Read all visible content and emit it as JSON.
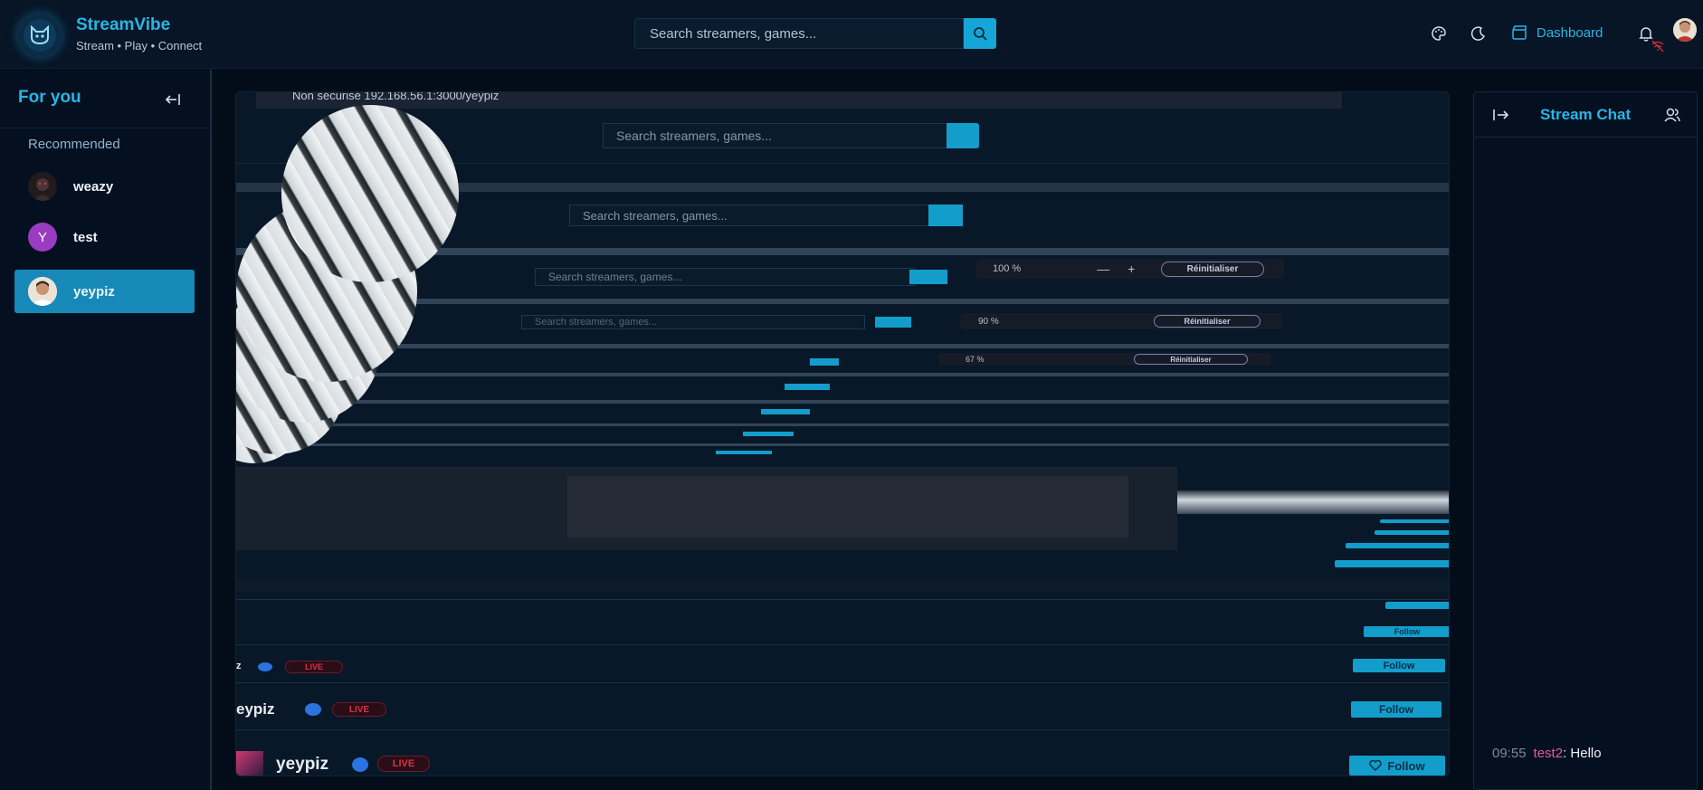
{
  "header": {
    "brand_title": "StreamVibe",
    "brand_subtitle": "Stream • Play • Connect",
    "search_placeholder": "Search streamers, games...",
    "dashboard_label": "Dashboard",
    "icons": [
      "palette-icon",
      "moon-icon",
      "clapperboard-icon",
      "bell-icon",
      "wifi-off-icon"
    ]
  },
  "sidebar": {
    "title": "For you",
    "section_label": "Recommended",
    "items": [
      {
        "name": "weazy",
        "avatar": "image"
      },
      {
        "name": "test",
        "avatar_letter": "Y",
        "avatar_color": "#9b3cc0"
      },
      {
        "name": "yeypiz",
        "avatar": "image",
        "active": true
      }
    ]
  },
  "stream": {
    "recursive_search_placeholder": "Search streamers, games...",
    "recursive_url_fragment": "Non sécurisé   192.168.56.1:3000/yeypiz",
    "zoom_levels": [
      "100 %",
      "90 %",
      "67 %"
    ],
    "reset_label": "Réinitialiser",
    "streamer_name": "yeypiz",
    "live_label": "LIVE",
    "follow_label": "Follow",
    "accent_color": "#139dcb",
    "live_color": "#d9304a"
  },
  "chat": {
    "title": "Stream Chat",
    "messages": [
      {
        "time": "09:55",
        "user": "test2",
        "text": ": Hello"
      }
    ]
  }
}
